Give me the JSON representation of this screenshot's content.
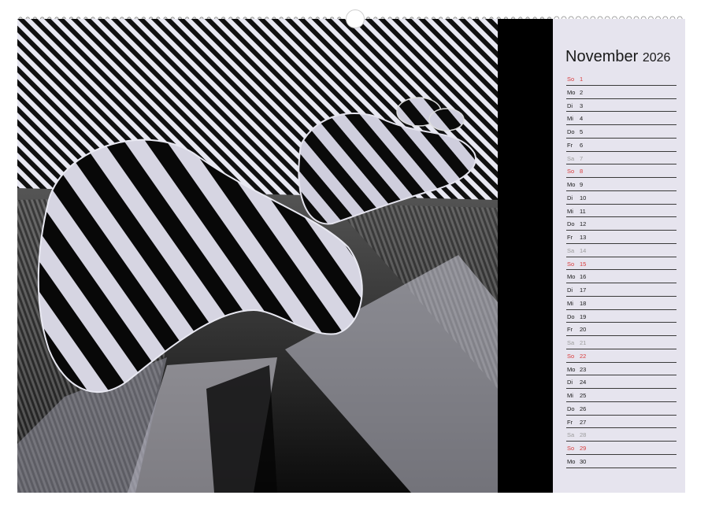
{
  "calendar": {
    "month": "November",
    "year": "2026",
    "days": [
      {
        "wd": "So",
        "num": "1",
        "type": "sun"
      },
      {
        "wd": "Mo",
        "num": "2",
        "type": "week"
      },
      {
        "wd": "Di",
        "num": "3",
        "type": "week"
      },
      {
        "wd": "Mi",
        "num": "4",
        "type": "week"
      },
      {
        "wd": "Do",
        "num": "5",
        "type": "week"
      },
      {
        "wd": "Fr",
        "num": "6",
        "type": "week"
      },
      {
        "wd": "Sa",
        "num": "7",
        "type": "sat"
      },
      {
        "wd": "So",
        "num": "8",
        "type": "sun"
      },
      {
        "wd": "Mo",
        "num": "9",
        "type": "week"
      },
      {
        "wd": "Di",
        "num": "10",
        "type": "week"
      },
      {
        "wd": "Mi",
        "num": "11",
        "type": "week"
      },
      {
        "wd": "Do",
        "num": "12",
        "type": "week"
      },
      {
        "wd": "Fr",
        "num": "13",
        "type": "week"
      },
      {
        "wd": "Sa",
        "num": "14",
        "type": "sat"
      },
      {
        "wd": "So",
        "num": "15",
        "type": "sun"
      },
      {
        "wd": "Mo",
        "num": "16",
        "type": "week"
      },
      {
        "wd": "Di",
        "num": "17",
        "type": "week"
      },
      {
        "wd": "Mi",
        "num": "18",
        "type": "week"
      },
      {
        "wd": "Do",
        "num": "19",
        "type": "week"
      },
      {
        "wd": "Fr",
        "num": "20",
        "type": "week"
      },
      {
        "wd": "Sa",
        "num": "21",
        "type": "sat"
      },
      {
        "wd": "So",
        "num": "22",
        "type": "sun"
      },
      {
        "wd": "Mo",
        "num": "23",
        "type": "week"
      },
      {
        "wd": "Di",
        "num": "24",
        "type": "week"
      },
      {
        "wd": "Mi",
        "num": "25",
        "type": "week"
      },
      {
        "wd": "Do",
        "num": "26",
        "type": "week"
      },
      {
        "wd": "Fr",
        "num": "27",
        "type": "week"
      },
      {
        "wd": "Sa",
        "num": "28",
        "type": "sat"
      },
      {
        "wd": "So",
        "num": "29",
        "type": "sun"
      },
      {
        "wd": "Mo",
        "num": "30",
        "type": "week"
      }
    ]
  },
  "colors": {
    "sunday": "#d93b3b",
    "saturday": "#9b9b9b",
    "weekday": "#1a1a1a",
    "panel": "#e6e4ee"
  }
}
